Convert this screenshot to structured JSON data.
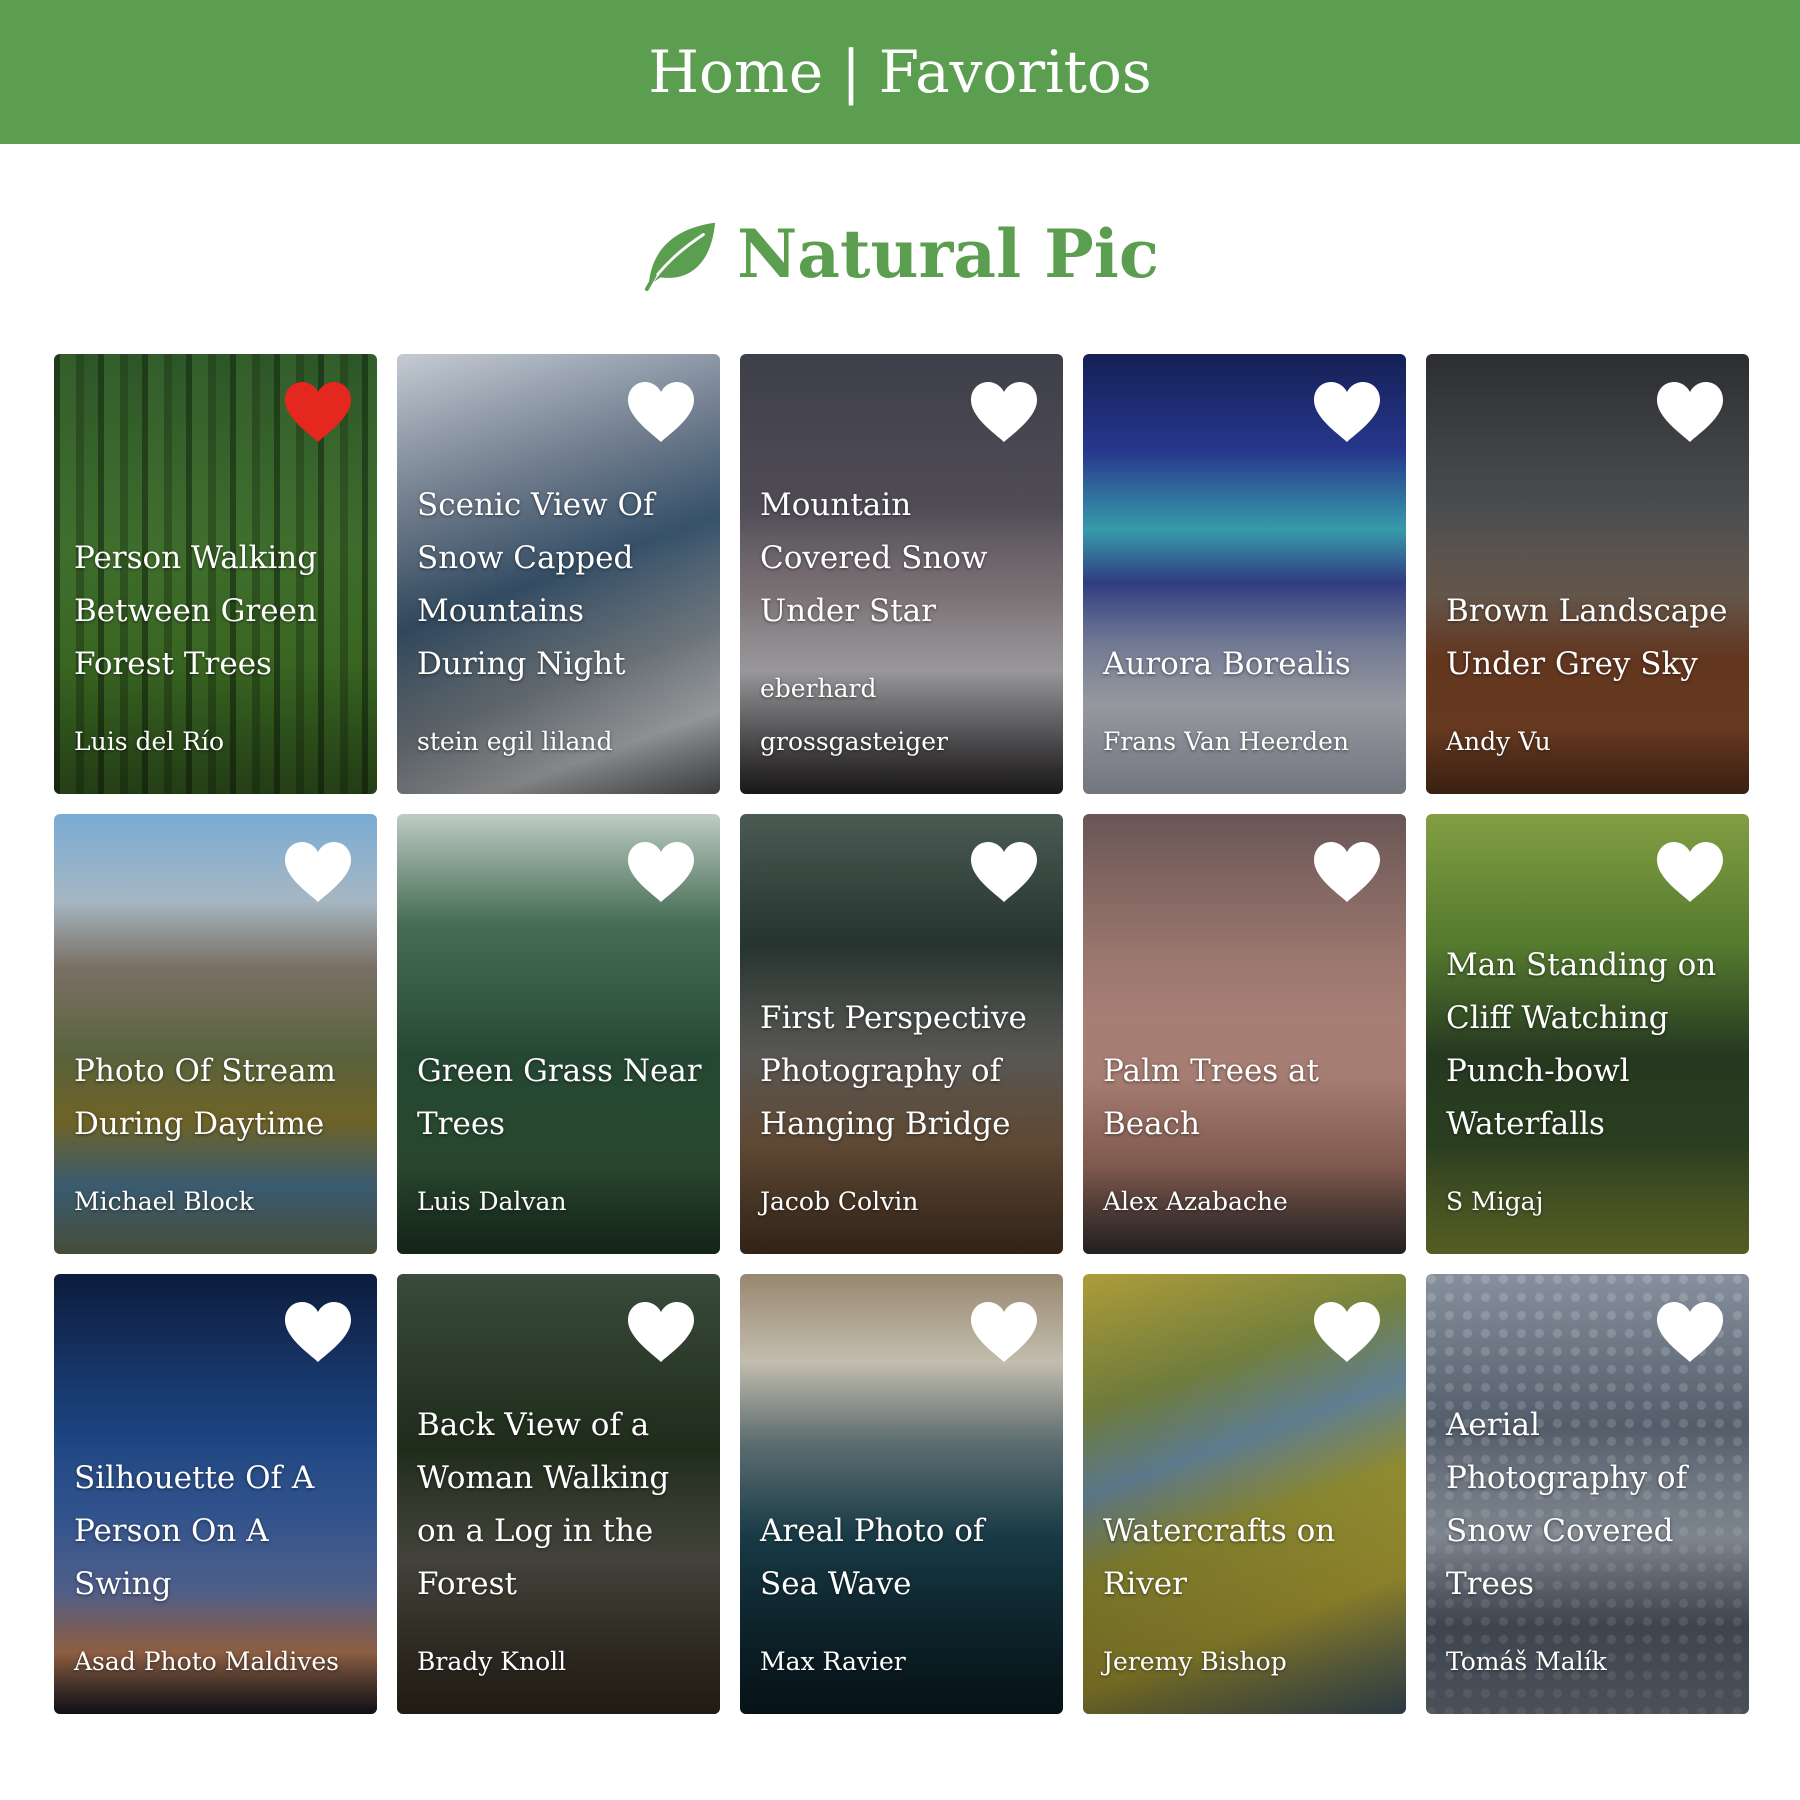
{
  "header": {
    "nav_home": "Home",
    "separator": "|",
    "nav_favorites": "Favoritos"
  },
  "brand": {
    "title": "Natural Pic",
    "icon": "leaf-icon",
    "color": "#5c9e4f"
  },
  "colors": {
    "header_bg": "#5c9e4f",
    "heart_active": "#e5281f",
    "heart_inactive": "#ffffff"
  },
  "cards": [
    {
      "title": "Person Walking Between Green Forest Trees",
      "author": "Luis del Río",
      "favorite": true
    },
    {
      "title": "Scenic View Of Snow Capped Mountains During Night",
      "author": "stein egil liland",
      "favorite": false
    },
    {
      "title": "Mountain Covered Snow Under Star",
      "author": "eberhard grossgasteiger",
      "favorite": false
    },
    {
      "title": "Aurora Borealis",
      "author": "Frans Van Heerden",
      "favorite": false
    },
    {
      "title": "Brown Landscape Under Grey Sky",
      "author": "Andy Vu",
      "favorite": false
    },
    {
      "title": "Photo Of Stream During Daytime",
      "author": "Michael Block",
      "favorite": false
    },
    {
      "title": "Green Grass Near Trees",
      "author": "Luis Dalvan",
      "favorite": false
    },
    {
      "title": "First Perspective Photography of Hanging Bridge",
      "author": "Jacob Colvin",
      "favorite": false
    },
    {
      "title": "Palm Trees at Beach",
      "author": "Alex Azabache",
      "favorite": false
    },
    {
      "title": "Man Standing on Cliff Watching Punch-bowl Waterfalls",
      "author": "S Migaj",
      "favorite": false
    },
    {
      "title": "Silhouette Of A Person On A Swing",
      "author": "Asad Photo Maldives",
      "favorite": false
    },
    {
      "title": "Back View of a Woman Walking on a Log in the Forest",
      "author": "Brady Knoll",
      "favorite": false
    },
    {
      "title": "Areal Photo of Sea Wave",
      "author": "Max Ravier",
      "favorite": false
    },
    {
      "title": "Watercrafts on River",
      "author": "Jeremy Bishop",
      "favorite": false
    },
    {
      "title": "Aerial Photography of Snow Covered Trees",
      "author": "Tomáš Malík",
      "favorite": false
    }
  ]
}
